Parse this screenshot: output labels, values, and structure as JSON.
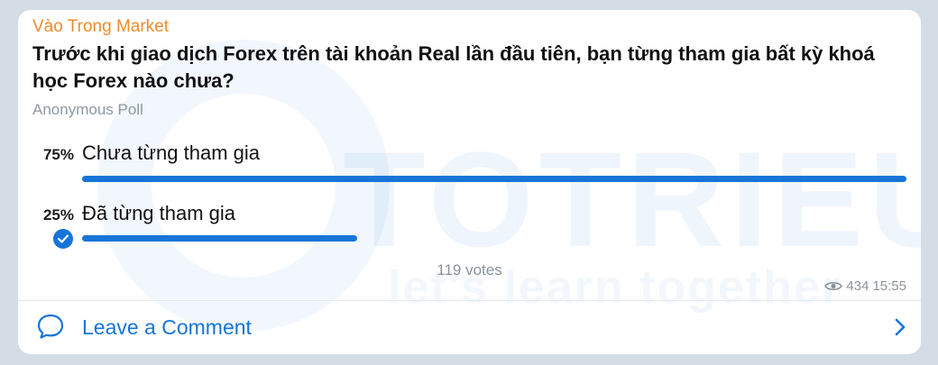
{
  "message": {
    "sender": "Vào Trong Market",
    "question": "Trước khi giao dịch Forex trên tài khoản Real lần đầu tiên, bạn từng tham gia bất kỳ khoá học Forex nào chưa?",
    "poll_type": "Anonymous Poll"
  },
  "poll": {
    "options": [
      {
        "percent_label": "75%",
        "label": "Chưa từng tham gia",
        "fraction": 0.75,
        "chosen": false
      },
      {
        "percent_label": "25%",
        "label": "Đã từng tham gia",
        "fraction": 0.25,
        "chosen": true
      }
    ],
    "votes_label": "119 votes"
  },
  "meta": {
    "views": "434",
    "time": "15:55"
  },
  "footer": {
    "comment_label": "Leave a Comment"
  },
  "watermark": {
    "brand": "TOTRIEU",
    "tagline": "let's learn together"
  },
  "colors": {
    "accent": "#1775d8",
    "sender": "#ee8b2c",
    "background": "#d4dde6"
  },
  "icons": {
    "check": "check-circle-icon",
    "views": "eye-icon",
    "comment": "speech-bubble-icon",
    "chevron": "chevron-right-icon"
  }
}
